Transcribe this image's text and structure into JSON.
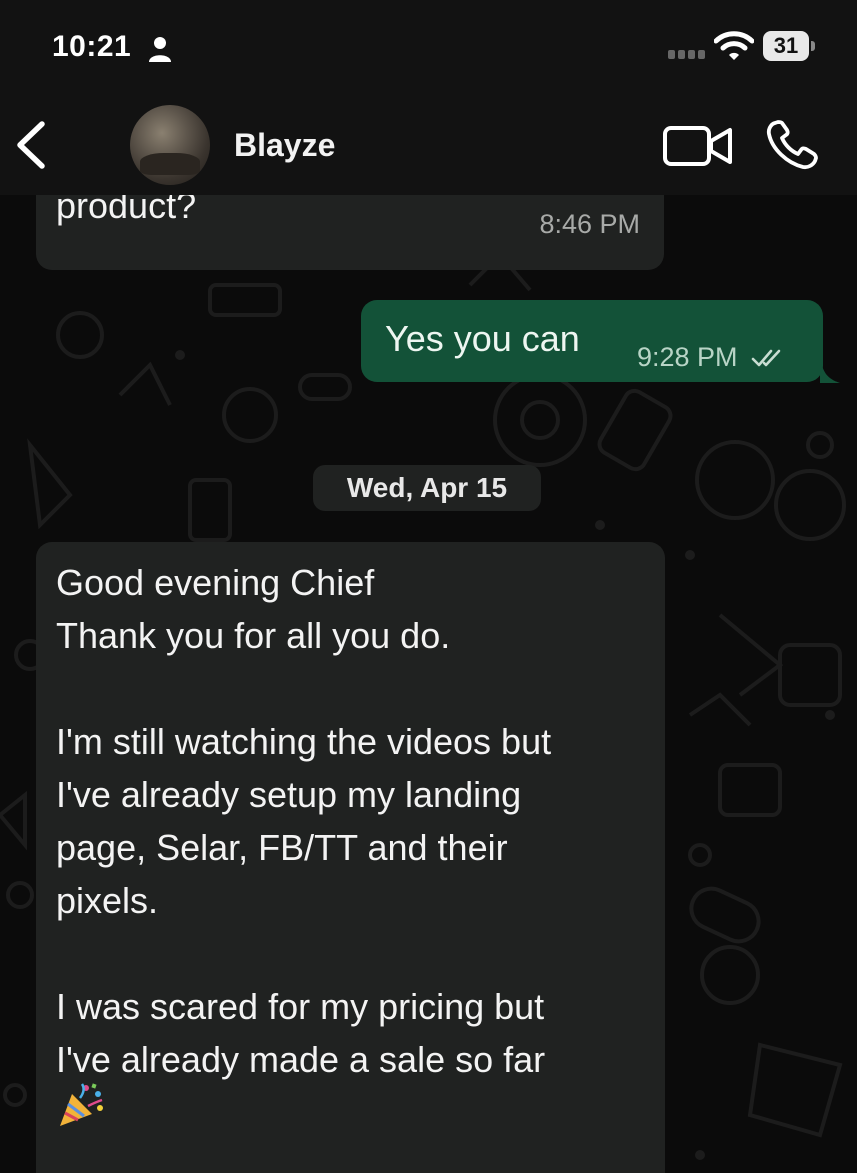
{
  "status_bar": {
    "time": "10:21",
    "battery": "31",
    "icons": [
      "person-icon",
      "signal-icon",
      "wifi-icon",
      "battery-icon"
    ]
  },
  "header": {
    "contact_name": "Blayze",
    "icons": [
      "back-icon",
      "avatar",
      "video-call-icon",
      "phone-icon"
    ]
  },
  "messages": [
    {
      "direction": "incoming",
      "text": "product?",
      "time": "8:46 PM"
    },
    {
      "direction": "outgoing",
      "text": "Yes you can",
      "time": "9:28 PM",
      "status": "read-double-check-icon"
    }
  ],
  "date_separator": "Wed, Apr 15",
  "message_long": {
    "direction": "incoming",
    "lines": [
      "Good evening Chief",
      "Thank you for all you do.",
      "",
      "I'm still watching the videos but",
      "I've already setup my landing",
      "page, Selar, FB/TT and their",
      "pixels.",
      "",
      "I was scared for my pricing but",
      "I've already made a sale so far"
    ],
    "emoji": "party-popper-icon"
  },
  "colors": {
    "background": "#0b0b0b",
    "header": "#121212",
    "incoming_bubble": "#202221",
    "outgoing_bubble": "#135238"
  }
}
